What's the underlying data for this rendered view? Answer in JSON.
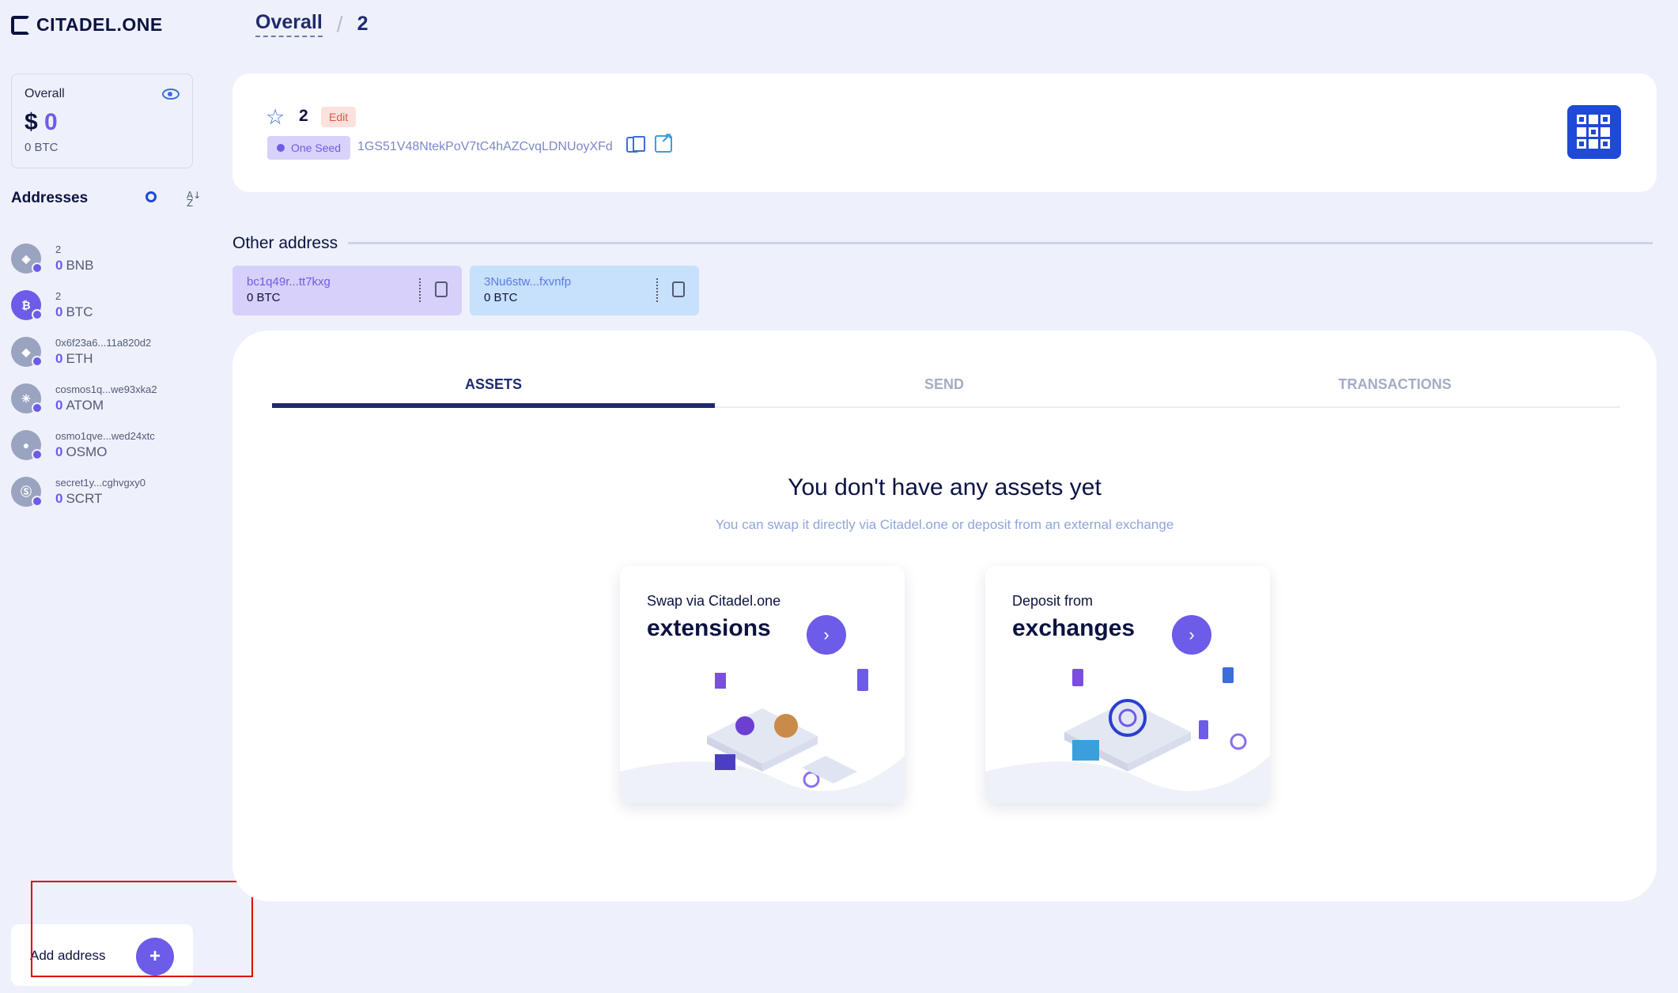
{
  "brand": {
    "name": "CITADEL.ONE"
  },
  "breadcrumb": {
    "root": "Overall",
    "separator": "/",
    "current": "2"
  },
  "overall": {
    "label": "Overall",
    "currency": "$",
    "usd_value": "0",
    "btc_value": "0 BTC"
  },
  "addresses": {
    "title": "Addresses",
    "items": [
      {
        "name": "2",
        "amount": "0",
        "ticker": "BNB",
        "icon": "bnb-icon",
        "glyph": "◈"
      },
      {
        "name": "2",
        "amount": "0",
        "ticker": "BTC",
        "icon": "btc-icon",
        "glyph": "₿"
      },
      {
        "name": "0x6f23a6...11a820d2",
        "amount": "0",
        "ticker": "ETH",
        "icon": "eth-icon",
        "glyph": "◆"
      },
      {
        "name": "cosmos1q...we93xka2",
        "amount": "0",
        "ticker": "ATOM",
        "icon": "atom-icon",
        "glyph": "✳"
      },
      {
        "name": "osmo1qve...wed24xtc",
        "amount": "0",
        "ticker": "OSMO",
        "icon": "osmo-icon",
        "glyph": "●"
      },
      {
        "name": "secret1y...cghvgxy0",
        "amount": "0",
        "ticker": "SCRT",
        "icon": "scrt-icon",
        "glyph": "Ⓢ"
      }
    ]
  },
  "add_address": {
    "label": "Add address",
    "plus": "+"
  },
  "wallet": {
    "star": "☆",
    "name": "2",
    "edit_label": "Edit",
    "seed_label": "One Seed",
    "address": "1GS51V48NtekPoV7tC4hAZCvqLDNUoyXFd"
  },
  "other_address": {
    "title": "Other address",
    "items": [
      {
        "address": "bc1q49r...tt7kxg",
        "balance": "0 BTC"
      },
      {
        "address": "3Nu6stw...fxvnfp",
        "balance": "0 BTC"
      }
    ]
  },
  "tabs": [
    {
      "label": "ASSETS",
      "active": true
    },
    {
      "label": "SEND",
      "active": false
    },
    {
      "label": "TRANSACTIONS",
      "active": false
    }
  ],
  "empty_state": {
    "title": "You don't have any assets yet",
    "subtitle": "You can swap it directly via Citadel.one or deposit from an external exchange"
  },
  "tiles": [
    {
      "small": "Swap via Citadel.one",
      "big": "extensions",
      "arrow": "›"
    },
    {
      "small": "Deposit from",
      "big": "exchanges",
      "arrow": "›"
    }
  ],
  "colors": {
    "accent": "#6c5ce7",
    "primary": "#1f2a6e",
    "background": "#eef1fb",
    "highlight": "#e00000"
  }
}
